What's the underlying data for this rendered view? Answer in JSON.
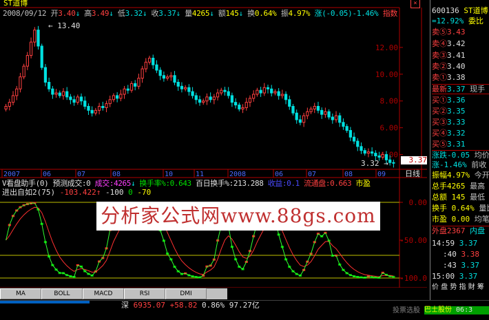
{
  "app": {
    "stock_name": "ST道博",
    "stock_code": "600136",
    "close_icon": "close-icon"
  },
  "header": {
    "date": "2008/09/12",
    "open_label": "开",
    "open": "3.40",
    "high_label": "高",
    "high": "3.49",
    "low_label": "低",
    "low": "3.32",
    "close_label": "收",
    "close": "3.37",
    "volume_label": "量",
    "volume": "4265",
    "amount_label": "额",
    "amount": "145",
    "turnover_label": "换",
    "turnover": "0.64%",
    "amplitude_label": "振",
    "amplitude": "4.97%",
    "change_label": "涨",
    "change": "(-0.05)-1.46%",
    "index_label": "指数"
  },
  "price_chart": {
    "high_mark": "13.40",
    "low_mark": "3.32",
    "current_price": "3.37",
    "y_ticks": [
      "12.00",
      "10.00",
      "8.00",
      "6.00",
      "4.00"
    ],
    "x_ticks": [
      "2007",
      "06",
      "07",
      "08",
      "10",
      "11",
      "2008",
      "06",
      "07",
      "08",
      "09"
    ],
    "axis_label": "日线"
  },
  "indicator_header": {
    "line1_title": "V看盘助手(0)",
    "forecast_label": "预测成交:",
    "forecast_value": "0",
    "volume_label": "成交:",
    "volume_value": "4265",
    "turnover_label": "换手率%:",
    "turnover_value": "0.643",
    "hundred_label": "百日换手%:",
    "hundred_value": "213.288",
    "profit_label": "收益:",
    "profit_value": "0.1",
    "float_label": "流通盘:",
    "float_value": "0.663",
    "market_label": "市盈",
    "line2_title": "进出自如2(75)",
    "line2_v1": "-103.422",
    "line2_v2": "-100",
    "line2_v3": "0",
    "line2_v4": "-70"
  },
  "watermark": "分析家公式网www.88gs.com",
  "indicator_chart": {
    "y_ticks": [
      "0.00",
      "-50.00",
      "-100.0"
    ]
  },
  "indicator_tabs": [
    "MA",
    "BOLL",
    "MACD",
    "RSI",
    "DMI"
  ],
  "quote_panel": {
    "code": "600136",
    "name": "ST道博",
    "ratio": "12.92%",
    "ratio_label": "委比",
    "ratio_extra": "委差",
    "sells": [
      {
        "label": "卖⑤",
        "price": "3.43"
      },
      {
        "label": "卖④",
        "price": "3.42"
      },
      {
        "label": "卖③",
        "price": "3.41"
      },
      {
        "label": "卖②",
        "price": "3.40"
      },
      {
        "label": "卖①",
        "price": "3.38"
      }
    ],
    "latest_label": "最新",
    "latest": "3.37",
    "latest_extra": "现手",
    "buys": [
      {
        "label": "买①",
        "price": "3.36"
      },
      {
        "label": "买②",
        "price": "3.35"
      },
      {
        "label": "买③",
        "price": "3.33"
      },
      {
        "label": "买④",
        "price": "3.32"
      },
      {
        "label": "买⑤",
        "price": "3.31"
      }
    ],
    "stats": [
      {
        "text": "涨跌-0.05",
        "extra": "均价"
      },
      {
        "text": "涨-1.46%",
        "extra": "前收"
      },
      {
        "text": "振幅4.97%",
        "extra": "今开"
      },
      {
        "text": "总手4265",
        "extra": "最高"
      },
      {
        "text": "总额 145",
        "extra": "最低"
      },
      {
        "text": "换手 0.64%",
        "extra": "量比"
      },
      {
        "text": "市盈  0.00",
        "extra": "均笔"
      }
    ],
    "outer_label": "外盘",
    "outer_value": "2367",
    "inner_label": "内盘",
    "ticks": [
      {
        "time": "14:59",
        "price": "3.37"
      },
      {
        "time": ":40",
        "price": "3.38"
      },
      {
        "time": ":43",
        "price": "3.37"
      },
      {
        "time": "15:00",
        "price": "3.37"
      }
    ],
    "bottom_tabs": "价 盘 势 指 財 筹"
  },
  "status_bar": {
    "index_label": "深",
    "index_value": "6935.07",
    "index_change": "+58.82",
    "index_pct": "0.86%",
    "index_amount": "97.27亿",
    "search_hint": "投票选股",
    "ticker_name": "巴士股份",
    "ticker_time": "06:3"
  },
  "colors": {
    "up": "#ff4040",
    "down": "#00e0e0",
    "axis": "#b00000",
    "yellow": "#ffff00",
    "green": "#00e000"
  },
  "chart_data": {
    "type": "candlestick",
    "ylim": [
      3,
      14
    ],
    "close_series": [
      7.6,
      7.9,
      8.4,
      8.9,
      9.8,
      10.6,
      11.4,
      12.4,
      13.3,
      12.1,
      10.5,
      9.4,
      8.9,
      8.5,
      8.6,
      8.4,
      8.7,
      8.3,
      8.1,
      7.9,
      8.3,
      8.0,
      7.6,
      7.3,
      7.1,
      7.3,
      7.6,
      7.5,
      7.8,
      8.1,
      8.4,
      8.2,
      8.5,
      8.9,
      8.8,
      9.3,
      9.1,
      9.7,
      10.4,
      10.9,
      11.2,
      10.7,
      10.3,
      9.9,
      9.7,
      9.8,
      9.9,
      9.4,
      9.1,
      8.9,
      9.0,
      8.7,
      8.4,
      8.1,
      7.9,
      8.0,
      8.3,
      8.1,
      8.3,
      8.6,
      8.8,
      8.7,
      8.4,
      7.9,
      7.7,
      7.4,
      7.5,
      7.9,
      8.2,
      8.5,
      8.8,
      8.6,
      9.0,
      8.9,
      8.6,
      8.7,
      8.4,
      8.5,
      8.1,
      7.6,
      7.1,
      6.6,
      6.4,
      6.9,
      7.2,
      7.4,
      7.6,
      7.3,
      7.0,
      7.2,
      6.8,
      6.6,
      6.9,
      6.4,
      6.1,
      5.8,
      5.3,
      5.0,
      4.6,
      4.3,
      4.1,
      4.2,
      4.1,
      3.9,
      3.8,
      4.0,
      3.6,
      3.4,
      3.37
    ]
  }
}
